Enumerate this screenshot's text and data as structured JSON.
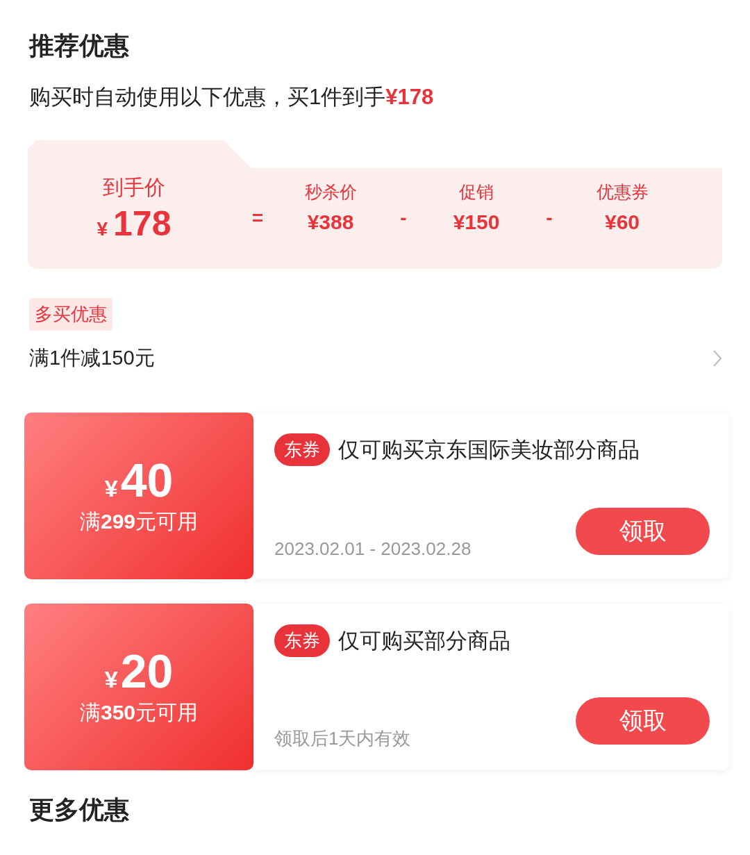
{
  "title": "推荐优惠",
  "summary": {
    "text": "购买时自动使用以下优惠，买1件到手",
    "price": "¥178"
  },
  "breakdown": {
    "final": {
      "label": "到手价",
      "currency": "¥",
      "amount": "178"
    },
    "items": [
      {
        "kind": "operator",
        "symbol": "="
      },
      {
        "kind": "term",
        "label": "秒杀价",
        "value": "¥388"
      },
      {
        "kind": "operator",
        "symbol": "-"
      },
      {
        "kind": "term",
        "label": "促销",
        "value": "¥150"
      },
      {
        "kind": "operator",
        "symbol": "-"
      },
      {
        "kind": "term",
        "label": "优惠券",
        "value": "¥60"
      }
    ]
  },
  "multi_buy": {
    "tag": "多买优惠",
    "rule": "满1件减150元"
  },
  "coupons": [
    {
      "currency": "¥",
      "amount": "40",
      "condition": "满**299**元可用",
      "tag": "东券",
      "description": "仅可购买京东国际美妆部分商品",
      "validity": "2023.02.01 - 2023.02.28",
      "button": "领取"
    },
    {
      "currency": "¥",
      "amount": "20",
      "condition": "满**350**元可用",
      "tag": "东券",
      "description": "仅可购买部分商品",
      "validity": "领取后1天内有效",
      "button": "领取"
    }
  ],
  "more_title": "更多优惠"
}
